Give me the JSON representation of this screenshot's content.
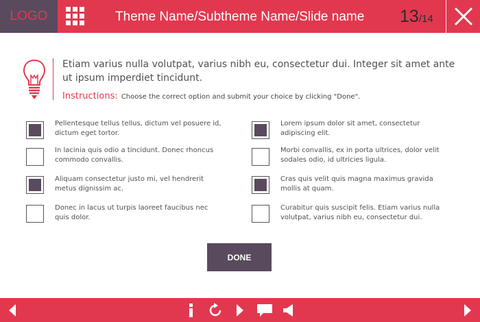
{
  "header": {
    "logo": "LOGO",
    "title": "Theme Name/Subtheme Name/Slide name",
    "page_current": "13",
    "page_total": "/14"
  },
  "intro": {
    "text": "Etiam varius nulla volutpat, varius nibh eu, consectetur dui. Integer sit amet ante ut ipsum imperdiet tincidunt.",
    "instructions_label": "Instructions:",
    "instructions_text": "Choose the correct option and submit your choice by clicking \"Done\"."
  },
  "options": [
    {
      "text": "Pellentesque tellus tellus, dictum vel posuere id, dictum eget tortor.",
      "checked": true
    },
    {
      "text": "Lorem ipsum dolor sit amet, consectetur adipiscing elit.",
      "checked": true
    },
    {
      "text": "In lacinia quis odio a tincidunt. Donec rhoncus commodo convallis.",
      "checked": false
    },
    {
      "text": "Morbi convallis, ex in porta ultrices, dolor velit sodales odio, id ultricies ligula.",
      "checked": false
    },
    {
      "text": "Aliquam consectetur justo mi, vel hendrerit metus dignissim ac.",
      "checked": true
    },
    {
      "text": "Cras quis velit quis magna maximus gravida mollis at quam.",
      "checked": true
    },
    {
      "text": "Donec in lacus ut turpis laoreet faucibus nec quis dolor.",
      "checked": false
    },
    {
      "text": "Curabitur quis suscipit felis. Etiam varius nulla volutpat, varius nibh eu, consectetur dui.",
      "checked": false
    }
  ],
  "done_label": "DONE",
  "footer_icons": [
    "prev-arrow-icon",
    "info-icon",
    "replay-icon",
    "play-icon",
    "comment-icon",
    "audio-icon",
    "next-arrow-icon"
  ],
  "colors": {
    "accent": "#e2384f",
    "dark": "#5a4a5e"
  }
}
